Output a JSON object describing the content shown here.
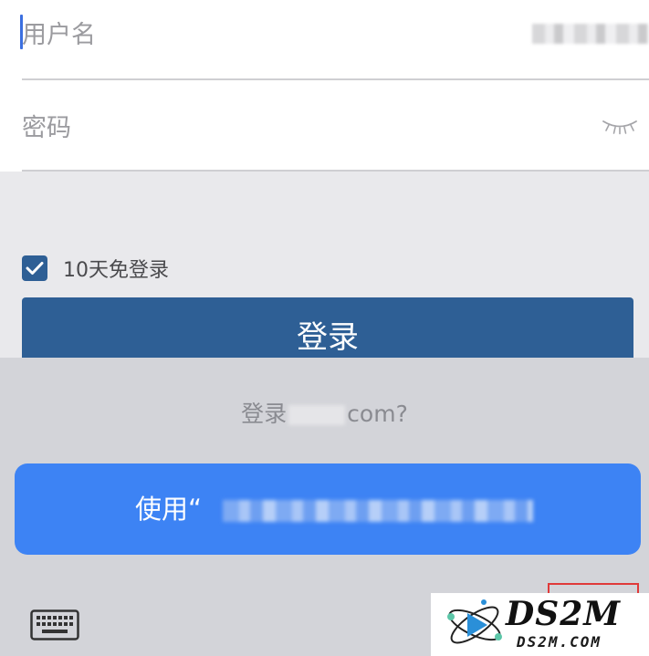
{
  "form": {
    "username_placeholder": "用户名",
    "password_placeholder": "密码",
    "remember_label": "10天免登录",
    "remember_checked": true,
    "login_label": "登录"
  },
  "sheet": {
    "prompt_prefix": "登录",
    "prompt_suffix": "com?",
    "use_prefix": "使用“"
  },
  "watermark": {
    "main": "DS2M",
    "sub": "DS2M.COM"
  },
  "colors": {
    "primary": "#2e5f95",
    "suggestion_button": "#3d83f4",
    "sheet_background": "#d3d4d9",
    "caret": "#3b6fe0"
  },
  "icons": {
    "password_visibility": "eye-closed-icon",
    "checkbox": "checkmark-icon",
    "keyboard": "keyboard-icon"
  }
}
